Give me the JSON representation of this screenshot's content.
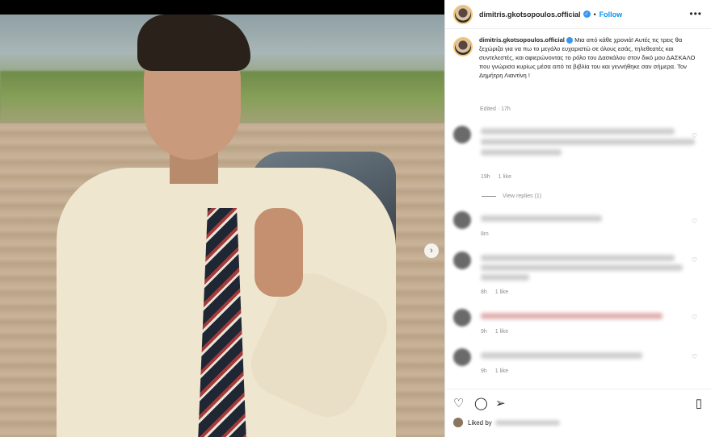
{
  "post": {
    "username": "dimitris.gkotsopoulos.official",
    "follow_label": "Follow",
    "more_label": "•••",
    "next_label": "›",
    "verified_mark": "✓",
    "separator": "•"
  },
  "caption": {
    "username": "dimitris.gkotsopoulos.official",
    "text": "Μια από κάθε χρονιά! Αυτές τις τρεις θα ξεχώριζα για να πω το μεγάλο ευχαριστώ σε όλους εσάς, τηλεθεατές και συντελεστές, και αφιερώνοντας το ρόλο του Δασκάλου στον δικό μου ΔΑΣΚΑΛΟ που γνώρισα κυρίως μέσα από τα βιβλία του και γεννήθηκε σαν σήμερα. Τον Δημήτρη Λιαντίνη !",
    "edited": "Edited · 17h"
  },
  "comments": [
    {
      "time": "19h",
      "likes": "1 like"
    },
    {
      "time": "8m",
      "likes": ""
    },
    {
      "time": "8h",
      "likes": "1 like"
    },
    {
      "time": "9h",
      "likes": "1 like"
    },
    {
      "time": "9h",
      "likes": "1 like"
    }
  ],
  "view_replies": "View replies (1)",
  "liked_by": "Liked by",
  "icons": {
    "heart": "♡",
    "comment": "◯",
    "share": "➢",
    "bookmark": "▯"
  },
  "colors": {
    "accent": "#0095f6",
    "text": "#262626",
    "muted": "#8e8e8e"
  }
}
